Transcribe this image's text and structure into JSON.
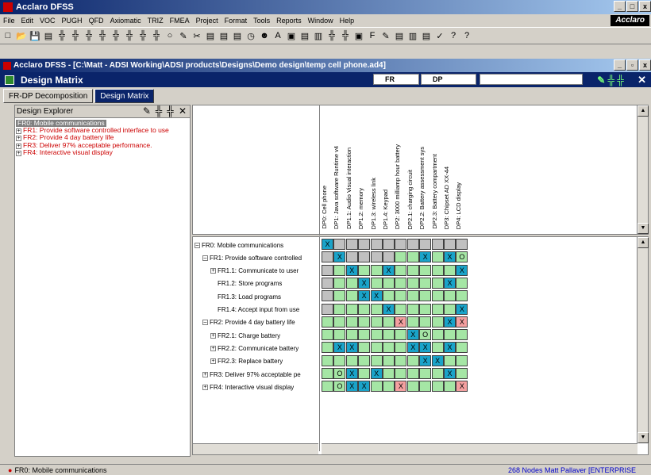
{
  "app_title": "Acclaro DFSS",
  "brand": "Acclaro",
  "menu": [
    "File",
    "Edit",
    "VOC",
    "PUGH",
    "QFD",
    "Axiomatic",
    "TRIZ",
    "FMEA",
    "Project",
    "Format",
    "Tools",
    "Reports",
    "Window",
    "Help"
  ],
  "doc_title": "Acclaro DFSS - [C:\\Matt - ADSI Working\\ADSI products\\Designs\\Demo design\\temp cell phone.ad4]",
  "panel_title": "Design Matrix",
  "fr_select": "FR",
  "dp_select": "DP",
  "tabs": [
    "FR-DP Decomposition",
    "Design Matrix"
  ],
  "explorer": {
    "title": "Design Explorer",
    "root": "FR0: Mobile communications",
    "items": [
      "FR1: Provide software controlled interface to use",
      "FR2: Provide 4 day battery life",
      "FR3: Deliver 97% acceptable performance.",
      "FR4: Interactive visual display"
    ]
  },
  "dps": [
    "DP0: Cell phone",
    "DP1: Java software Runtime v4",
    "DP1.1: Audio Visual interaction",
    "DP1.2: memory",
    "DP1.3: wireless link",
    "DP1.4: Keypad",
    "DP2: 3000 milliamp hour battery",
    "DP2.1: charging circuit",
    "DP2.2: Battery assessment sys",
    "DP2.3: Battery compartment",
    "DP3: Chipset AD XX-44",
    "DP4: LCD display"
  ],
  "frs": [
    {
      "label": "FR0: Mobile communications",
      "level": 0,
      "exp": "minus"
    },
    {
      "label": "FR1: Provide software controlled",
      "level": 1,
      "exp": "minus"
    },
    {
      "label": "FR1.1: Communicate to user",
      "level": 2,
      "exp": "plus"
    },
    {
      "label": "FR1.2: Store programs",
      "level": 2,
      "exp": ""
    },
    {
      "label": "FR1.3: Load programs",
      "level": 2,
      "exp": ""
    },
    {
      "label": "FR1.4: Accept input from use",
      "level": 2,
      "exp": ""
    },
    {
      "label": "FR2: Provide 4 day battery life",
      "level": 1,
      "exp": "minus"
    },
    {
      "label": "FR2.1: Charge battery",
      "level": 2,
      "exp": "plus"
    },
    {
      "label": "FR2.2: Communicate battery",
      "level": 2,
      "exp": "plus"
    },
    {
      "label": "FR2.3: Replace battery",
      "level": 2,
      "exp": "plus"
    },
    {
      "label": "FR3: Deliver 97% acceptable pe",
      "level": 1,
      "exp": "plus"
    },
    {
      "label": "FR4: Interactive visual display",
      "level": 1,
      "exp": "plus"
    }
  ],
  "matrix": [
    "X.........................",
    "GXGGGGGGXGXO",
    "GGXGGXGGGGGX",
    "GGGXGGGGGGXG",
    "GGGXXGGGGGGG",
    "GGGGGXGGGGGX",
    "GGGGGGRGGGXR",
    "GGGGGGGXOGGG",
    "GXXGGGGXXGXG",
    "GGGGGGGGXXGG",
    "GOXGXGGGGGXG",
    "GOXXGGRGGGGR"
  ],
  "status": {
    "left": "FR0: Mobile communications",
    "right": "268 Nodes Matt Pallaver [ENTERPRISE"
  },
  "colors": {
    "title": "#0a246a",
    "dark": "#c0c0c0",
    "green": "#a5e6a5",
    "blue": "#1aa3c9",
    "red": "#f4a0a0"
  }
}
